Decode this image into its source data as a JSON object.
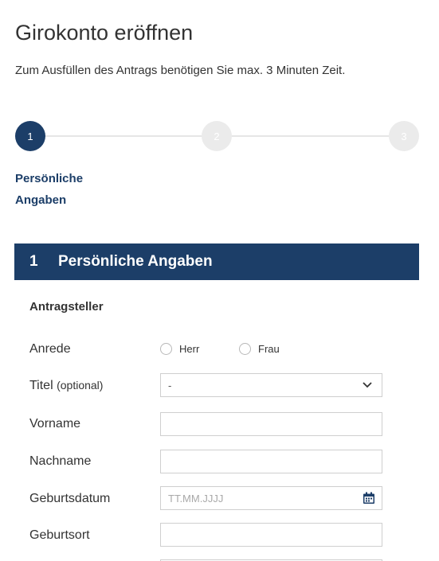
{
  "header": {
    "title": "Girokonto eröffnen",
    "intro": "Zum Ausfüllen des Antrags benötigen Sie max. 3 Minuten Zeit."
  },
  "stepper": {
    "steps": [
      {
        "number": "1",
        "state": "active"
      },
      {
        "number": "2",
        "state": "inactive"
      },
      {
        "number": "3",
        "state": "inactive"
      }
    ],
    "active_label_line1": "Persönliche",
    "active_label_line2": "Angaben"
  },
  "section": {
    "number": "1",
    "title": "Persönliche Angaben",
    "subheading": "Antragsteller"
  },
  "form": {
    "anrede": {
      "label": "Anrede",
      "options": [
        "Herr",
        "Frau"
      ]
    },
    "titel": {
      "label": "Titel",
      "optional": "(optional)",
      "selected": "-"
    },
    "vorname": {
      "label": "Vorname",
      "value": ""
    },
    "nachname": {
      "label": "Nachname",
      "value": ""
    },
    "geburtsdatum": {
      "label": "Geburtsdatum",
      "placeholder": "TT.MM.JJJJ"
    },
    "geburtsort": {
      "label": "Geburtsort",
      "value": ""
    }
  },
  "colors": {
    "brand": "#1c3e68",
    "step_inactive": "#ebebeb",
    "field_border": "#cfcfcf"
  },
  "icons": {
    "select": "chevron-down-icon",
    "date": "calendar-icon"
  }
}
